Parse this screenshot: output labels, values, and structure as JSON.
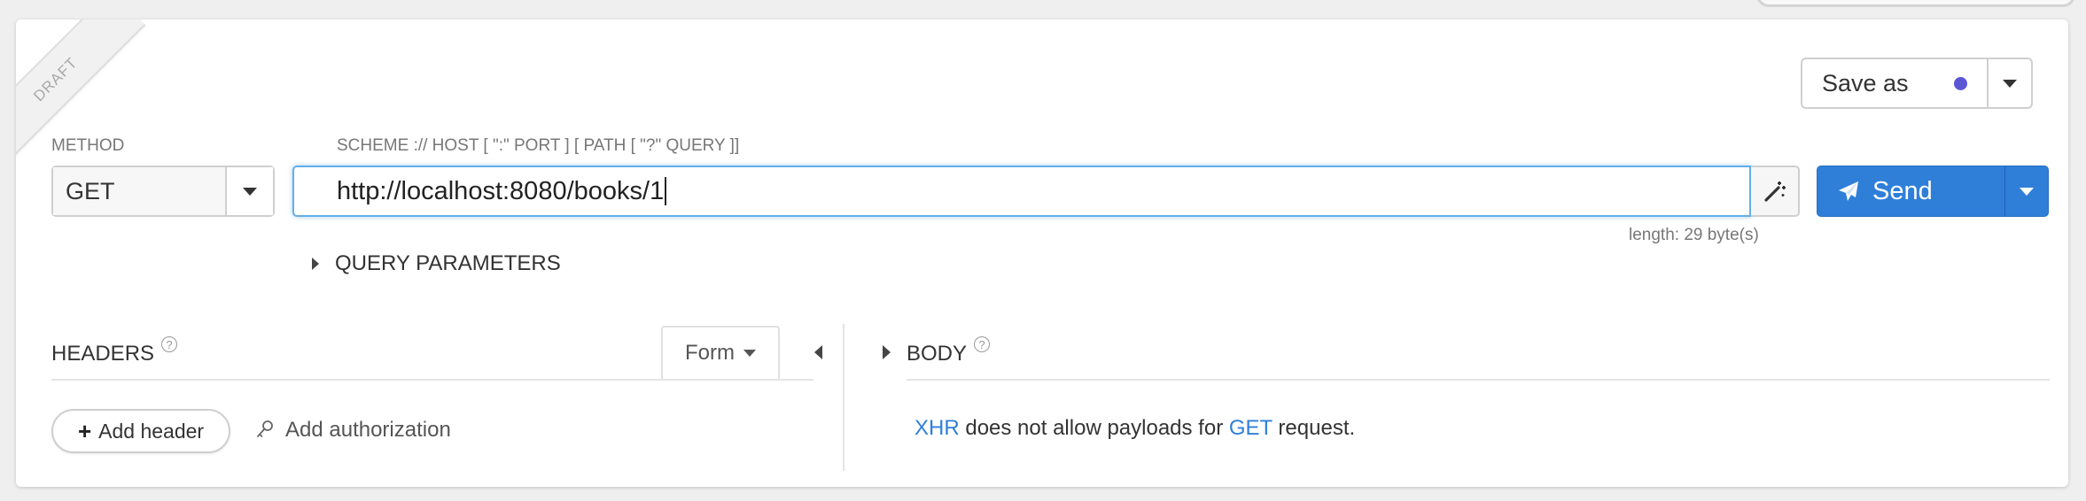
{
  "draft_label": "DRAFT",
  "save": {
    "label": "Save as",
    "dot_color": "#5b57d4"
  },
  "request": {
    "method_label": "METHOD",
    "method_value": "GET",
    "url_label": "SCHEME :// HOST [ \":\" PORT ] [ PATH [ \"?\" QUERY ]]",
    "url_value": "http://localhost:8080/books/1",
    "length_text": "length: 29 byte(s)",
    "send_label": "Send",
    "query_params_label": "QUERY PARAMETERS"
  },
  "headers": {
    "title": "HEADERS",
    "help": "?",
    "form_tab": "Form",
    "add_header": "Add header",
    "add_authorization": "Add authorization"
  },
  "body": {
    "title": "BODY",
    "help": "?",
    "msg_xhr": "XHR",
    "msg_mid": " does not allow payloads for ",
    "msg_get": "GET",
    "msg_end": " request."
  },
  "colors": {
    "accent": "#2f7fd9",
    "url_focus": "#66aee8",
    "save_dot": "#5b57d4"
  },
  "icons": [
    "magic-wand-icon",
    "paper-plane-icon",
    "key-icon",
    "plus-icon",
    "chevron-down-icon",
    "triangle-right-icon",
    "triangle-left-icon",
    "help-icon"
  ]
}
